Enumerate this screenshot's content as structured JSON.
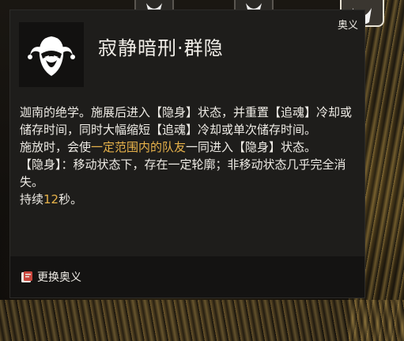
{
  "card": {
    "tag": "奥义",
    "title": "寂静暗刑·群隐",
    "portrait_icon": "masked-jester-icon",
    "description": {
      "p1": "迦南的绝学。施展后进入【隐身】状态，并重置【追魂】冷却或储存时间，同时大幅缩短【追魂】冷却或单次储存时间。",
      "p2_before": "施放时，会使",
      "p2_highlight": "一定范围内的队友",
      "p2_after": "一同进入【隐身】状态。",
      "p3": "【隐身】：移动状态下，存在一定轮廓；非移动状态几乎完全消失。",
      "p4_before": "持续",
      "p4_value": "12",
      "p4_after": "秒。"
    },
    "footer": {
      "icon": "swap-book-icon",
      "label": "更换奥义"
    }
  },
  "colors": {
    "highlight": "#e7b24a",
    "panel": "#1e1d1b",
    "footer": "#141312"
  }
}
